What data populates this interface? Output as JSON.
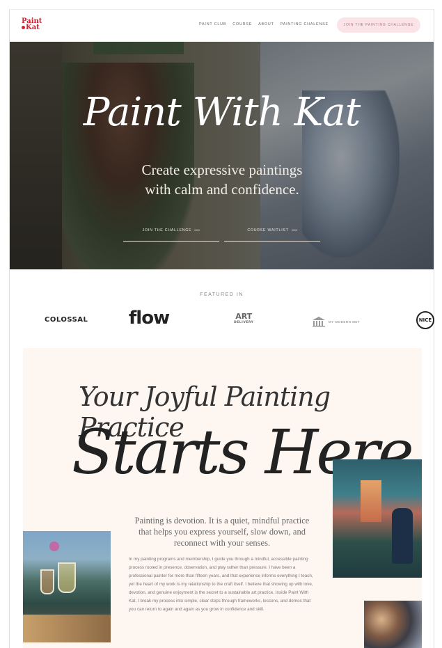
{
  "header": {
    "logo_line1": "Paint",
    "logo_line2": "Kat",
    "nav": [
      "PAINT CLUB",
      "COURSE",
      "ABOUT",
      "PAINTING CHALENSE"
    ],
    "cta_label": "JOIN THE PAINTING CHALLENGE"
  },
  "hero": {
    "title": "Paint With Kat",
    "subtitle": "Create expressive paintings with calm and confidence.",
    "button_left": "JOIN THE CHALLENGE",
    "button_right": "COURSE WAITLIST"
  },
  "featured": {
    "label": "FEATURED IN",
    "logos": [
      "COLOSSAL",
      "flow",
      "ART",
      "DELIVERY",
      "MY MODERN MET",
      "NICE"
    ]
  },
  "intro": {
    "script_line1": "Your Joyful Painting Practice",
    "script_line2": "Starts Here",
    "lead": "Painting is devotion. It is a quiet, mindful practice that helps you express yourself, slow down, and reconnect with your senses.",
    "body": "In my painting programs and membership, I guide you through a mindful, accessible painting process rooted in presence, observation, and play rather than pressure. I have been a professional painter for more than fifteen years, and that experience informs everything I teach, yet the heart of my work is my relationship to the craft itself. I believe that showing up with love, devotion, and genuine enjoyment is the secret to a sustainable art practice. Inside Paint With Kat, I break my process into simple, clear steps through frameworks, lessons, and demos that you can return to again and again as you grow in confidence and skill."
  },
  "colors": {
    "brand_red": "#d6202f",
    "cta_pink": "#fbe4e8",
    "section_bg": "#fdf6f1"
  }
}
